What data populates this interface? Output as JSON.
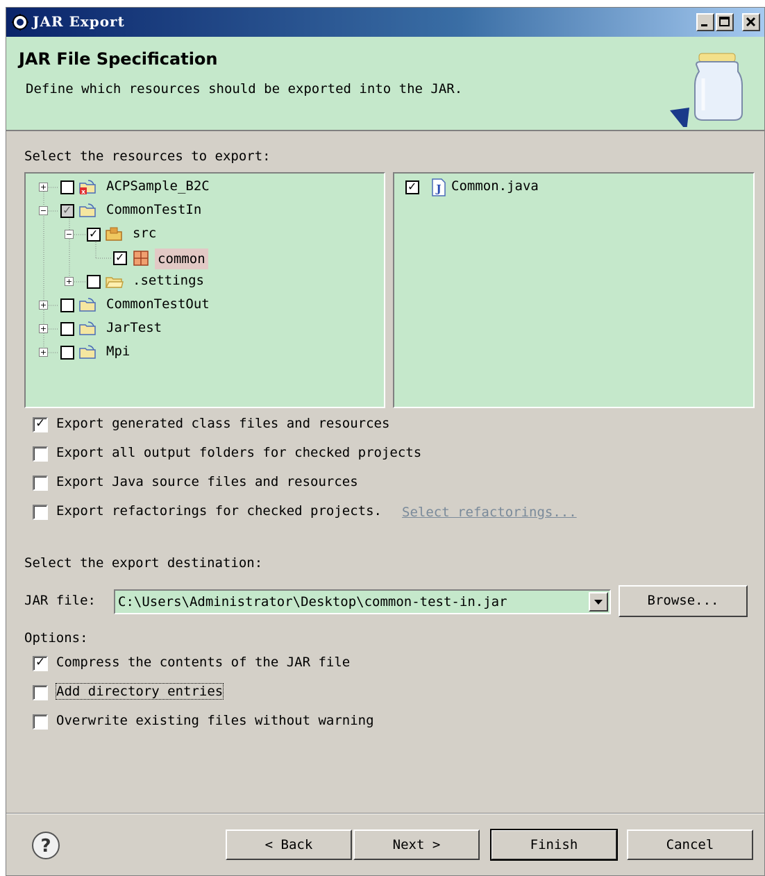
{
  "window": {
    "title": "JAR Export"
  },
  "header": {
    "title": "JAR File Specification",
    "description": "Define which resources should be exported into the JAR."
  },
  "resources": {
    "label": "Select the resources to export:",
    "tree": [
      {
        "label": "ACPSample_B2C",
        "expander": "+",
        "checked": false
      },
      {
        "label": "CommonTestIn",
        "expander": "-",
        "checked": "partial"
      },
      {
        "label": "src",
        "expander": "-",
        "checked": true
      },
      {
        "label": "common",
        "expander": "",
        "checked": true,
        "selected": true
      },
      {
        "label": ".settings",
        "expander": "+",
        "checked": false
      },
      {
        "label": "CommonTestOut",
        "expander": "+",
        "checked": false
      },
      {
        "label": "JarTest",
        "expander": "+",
        "checked": false
      },
      {
        "label": "Mpi",
        "expander": "+",
        "checked": false
      }
    ],
    "files": [
      {
        "label": "Common.java",
        "checked": true
      }
    ]
  },
  "export_options": [
    {
      "label": "Export generated class files and resources",
      "checked": true
    },
    {
      "label": "Export all output folders for checked projects",
      "checked": false
    },
    {
      "label": "Export Java source files and resources",
      "checked": false
    },
    {
      "label": "Export refactorings for checked projects.",
      "checked": false
    }
  ],
  "select_refactorings_link": "Select refactorings...",
  "destination": {
    "label": "Select the export destination:",
    "jar_file_label": "JAR file:",
    "jar_file_value": "C:\\Users\\Administrator\\Desktop\\common-test-in.jar",
    "browse_label": "Browse..."
  },
  "options": {
    "label": "Options:",
    "items": [
      {
        "label": "Compress the contents of the JAR file",
        "checked": true
      },
      {
        "label": "Add directory entries",
        "checked": false
      },
      {
        "label": "Overwrite existing files without warning",
        "checked": false
      }
    ]
  },
  "buttons": {
    "back": "< Back",
    "next": "Next >",
    "finish": "Finish",
    "cancel": "Cancel"
  },
  "colors": {
    "panel_bg": "#c5e8cb",
    "dialog_bg": "#d4d0c8",
    "title_bar": "#0a246a"
  }
}
